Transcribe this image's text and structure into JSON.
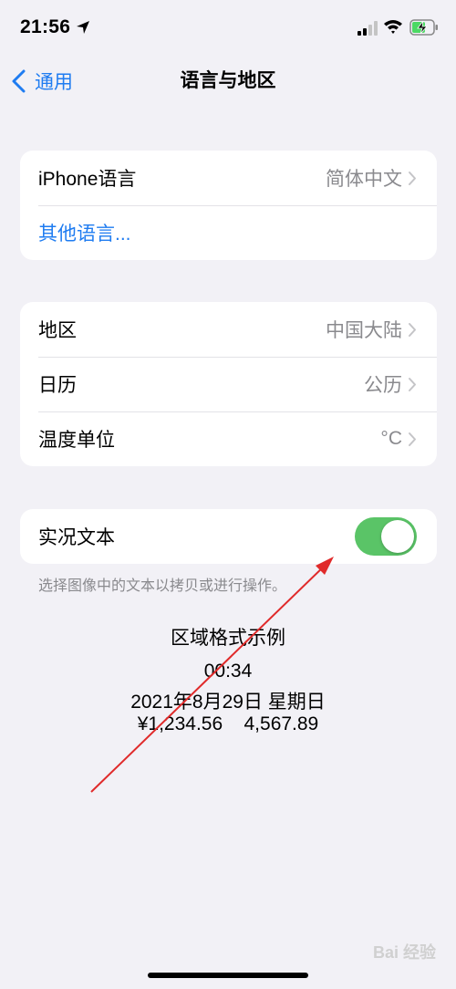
{
  "status_bar": {
    "time": "21:56"
  },
  "nav": {
    "back_label": "通用",
    "title": "语言与地区"
  },
  "language_section": {
    "iphone_language_label": "iPhone语言",
    "iphone_language_value": "简体中文",
    "other_languages_label": "其他语言..."
  },
  "region_section": {
    "region_label": "地区",
    "region_value": "中国大陆",
    "calendar_label": "日历",
    "calendar_value": "公历",
    "temperature_label": "温度单位",
    "temperature_value": "°C"
  },
  "live_text": {
    "label": "实况文本",
    "enabled": true,
    "footnote": "选择图像中的文本以拷贝或进行操作。"
  },
  "region_format_example": {
    "title": "区域格式示例",
    "time": "00:34",
    "date": "2021年8月29日 星期日",
    "numbers": "¥1,234.56    4,567.89"
  },
  "watermark": "Bai 经验",
  "colors": {
    "accent": "#1f7cf1",
    "toggle_on": "#5ac467",
    "background": "#f2f1f6",
    "annotation_arrow": "#e02a2a"
  }
}
